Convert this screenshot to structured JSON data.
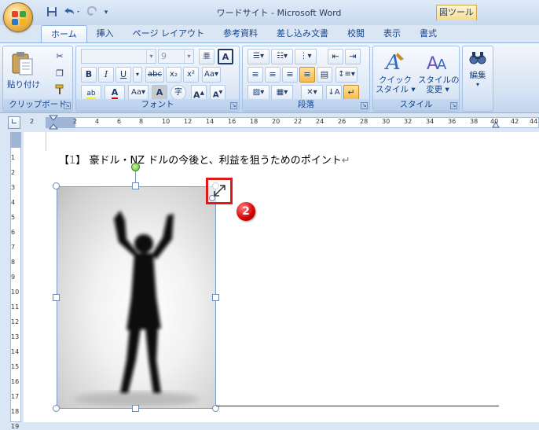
{
  "window": {
    "title": "ワードサイト - Microsoft Word",
    "context_tab": "図ツール"
  },
  "quick_access": {
    "icons": [
      "save-icon",
      "undo-icon",
      "redo-icon",
      "customize-icon"
    ]
  },
  "tabs": [
    {
      "label": "ホーム",
      "active": true
    },
    {
      "label": "挿入"
    },
    {
      "label": "ページ レイアウト"
    },
    {
      "label": "参考資料"
    },
    {
      "label": "差し込み文書"
    },
    {
      "label": "校閲"
    },
    {
      "label": "表示"
    },
    {
      "label": "書式"
    }
  ],
  "ribbon": {
    "clipboard": {
      "label": "クリップボード",
      "paste": "貼り付け"
    },
    "font": {
      "label": "フォント",
      "font_name": "",
      "font_size": "9"
    },
    "paragraph": {
      "label": "段落"
    },
    "style": {
      "label": "スタイル",
      "quick_style_1": "クイック",
      "quick_style_2": "スタイル",
      "change_style_1": "スタイルの",
      "change_style_2": "変更"
    },
    "editing": {
      "label": "編集"
    }
  },
  "ruler": {
    "h_ticks": [
      "2",
      "2",
      "4",
      "6",
      "8",
      "10",
      "12",
      "14",
      "16",
      "18",
      "20",
      "22",
      "24",
      "26",
      "28",
      "30",
      "32",
      "34",
      "36",
      "38",
      "40",
      "42",
      "44"
    ],
    "v_ticks": [
      "1",
      "2",
      "3",
      "4",
      "5",
      "6",
      "7",
      "8",
      "9",
      "10",
      "11",
      "12",
      "13",
      "14",
      "15",
      "16",
      "17",
      "18",
      "19"
    ]
  },
  "document": {
    "heading_bracket_open": "【",
    "heading_num": "1",
    "heading_bracket_close": "】",
    "heading_text": "豪ドル・NZ ドルの今後と、利益を狙うためのポイント",
    "para_mark": "↵"
  },
  "annotation": {
    "badge_number": "2",
    "accent": "#e01818"
  }
}
